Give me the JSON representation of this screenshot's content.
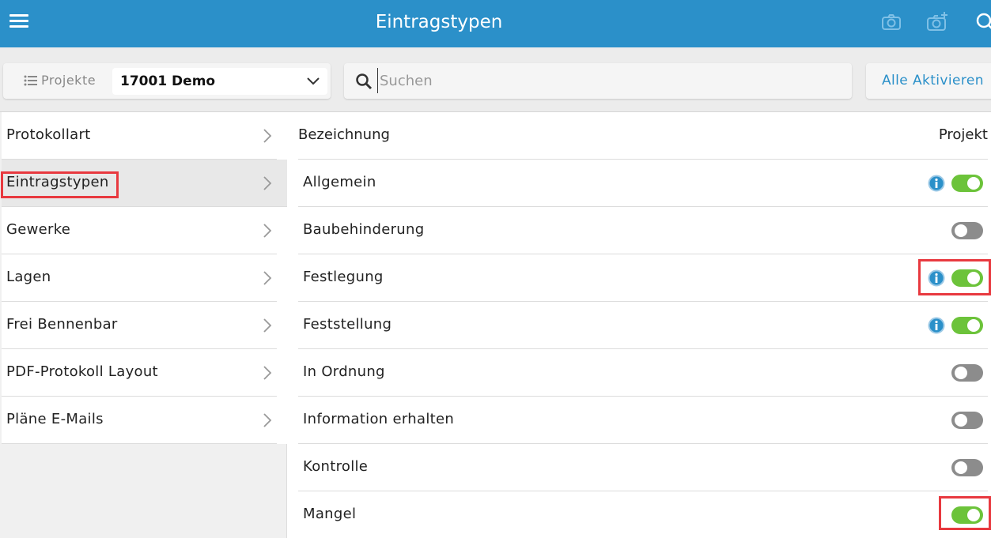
{
  "header": {
    "title": "Eintragstypen",
    "icons": [
      "menu-icon",
      "camera-icon",
      "camera-add-icon",
      "search-icon"
    ]
  },
  "toolbar": {
    "projects_label": "Projekte",
    "project_selected": "17001 Demo",
    "search_placeholder": "Suchen",
    "search_value": "",
    "activate_all_label": "Alle Aktivieren"
  },
  "sidebar": {
    "items": [
      {
        "label": "Protokollart",
        "active": false
      },
      {
        "label": "Eintragstypen",
        "active": true
      },
      {
        "label": "Gewerke",
        "active": false
      },
      {
        "label": "Lagen",
        "active": false
      },
      {
        "label": "Frei Bennenbar",
        "active": false
      },
      {
        "label": "PDF-Protokoll Layout",
        "active": false
      },
      {
        "label": "Pläne E-Mails",
        "active": false
      }
    ]
  },
  "list": {
    "col_name": "Bezeichnung",
    "col_project": "Projekt",
    "rows": [
      {
        "name": "Allgemein",
        "info": true,
        "enabled": true
      },
      {
        "name": "Baubehinderung",
        "info": false,
        "enabled": false
      },
      {
        "name": "Festlegung",
        "info": true,
        "enabled": true
      },
      {
        "name": "Feststellung",
        "info": true,
        "enabled": true
      },
      {
        "name": "In Ordnung",
        "info": false,
        "enabled": false
      },
      {
        "name": "Information erhalten",
        "info": false,
        "enabled": false
      },
      {
        "name": "Kontrolle",
        "info": false,
        "enabled": false
      },
      {
        "name": "Mangel",
        "info": false,
        "enabled": true
      }
    ]
  },
  "colors": {
    "header_bg": "#2b90c9",
    "toggle_on": "#6cc33a",
    "toggle_off": "#8c8c8c",
    "highlight": "#e8393f",
    "info_icon": "#2b90c9"
  }
}
